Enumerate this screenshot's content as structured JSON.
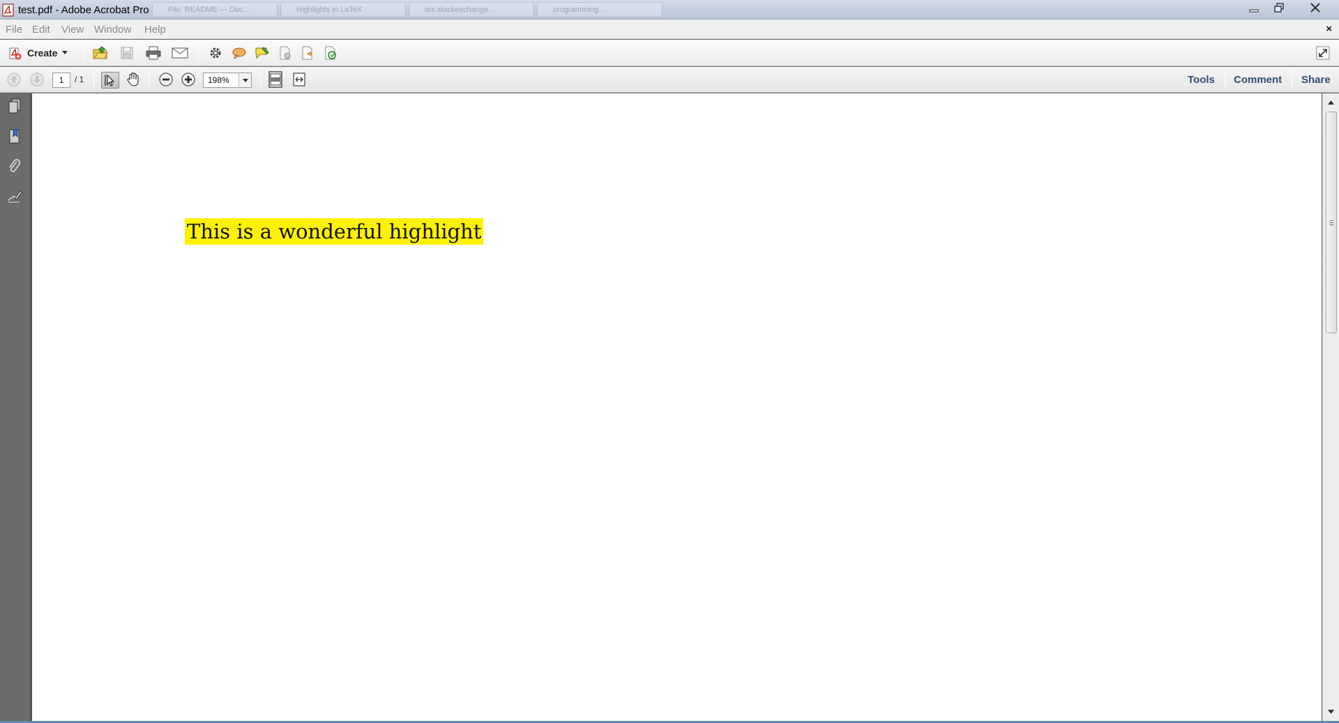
{
  "window": {
    "title": "test.pdf - Adobe Acrobat Pro",
    "background_tabs": [
      "File: README — Doc...",
      "Highlights in LaTeX",
      "tex.stackexchange...",
      "programming..."
    ]
  },
  "menu": {
    "items": [
      "File",
      "Edit",
      "View",
      "Window",
      "Help"
    ],
    "close_glyph": "×"
  },
  "toolbar": {
    "create_label": "Create",
    "icons": [
      "open-icon",
      "save-icon",
      "print-icon",
      "email-icon",
      "settings-icon",
      "comment-icon",
      "sticky-note-icon",
      "document-icon",
      "export-icon",
      "collaborate-icon",
      "expand-icon"
    ]
  },
  "navigation": {
    "current_page": "1",
    "page_total": "/ 1",
    "zoom": "198%"
  },
  "panes": {
    "tools": "Tools",
    "comment": "Comment",
    "share": "Share"
  },
  "document": {
    "highlight_text": "This is a wonderful highlight",
    "highlight_color": "#fff200"
  },
  "colors": {
    "nav_pane": "#6b6b6b",
    "link_blue": "#2f4f72"
  }
}
